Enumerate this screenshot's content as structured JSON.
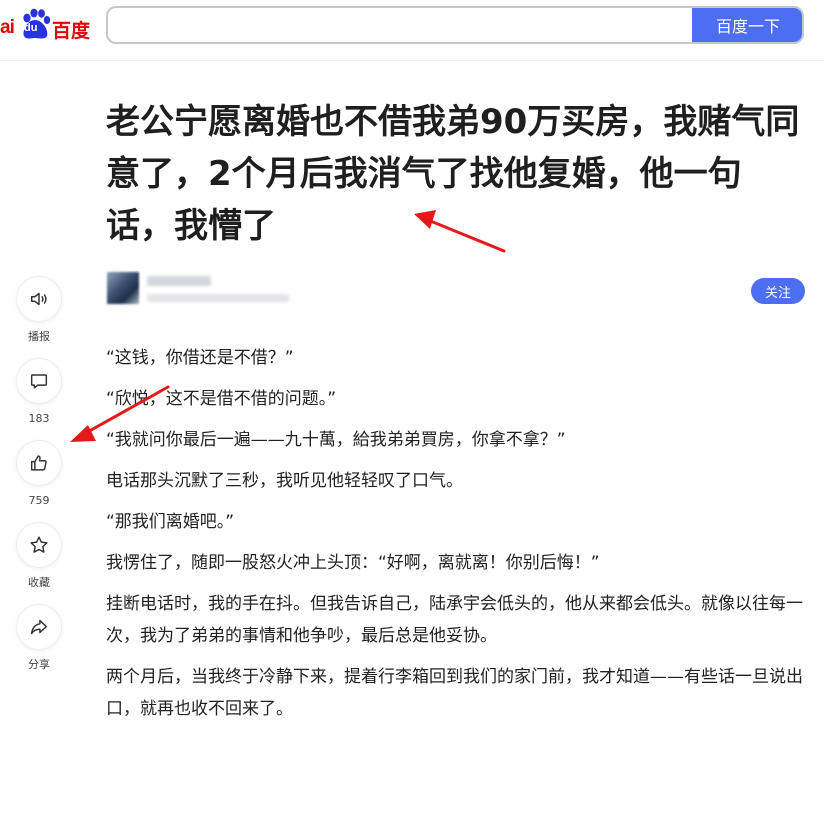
{
  "header": {
    "logo": {
      "ai": "ai",
      "du": "du",
      "cn": "百度"
    },
    "search": {
      "value": "",
      "placeholder": ""
    },
    "search_button": "百度一下"
  },
  "article": {
    "title": "老公宁愿离婚也不借我弟90万买房，我赌气同意了，2个月后我消气了找他复婚，他一句话，我懵了",
    "follow_button": "关注",
    "paragraphs": [
      "“这钱，你借还是不借？”",
      "“欣悦，这不是借不借的问题。”",
      "“我就问你最后一遍——九十萬，給我弟弟買房，你拿不拿？”",
      "电话那头沉默了三秒，我听见他轻轻叹了口气。",
      "“那我们离婚吧。”",
      "我愣住了，随即一股怒火冲上头顶：“好啊，离就离！你别后悔！”",
      "挂断电话时，我的手在抖。但我告诉自己，陆承宇会低头的，他从来都会低头。就像以往每一次，我为了弟弟的事情和他争吵，最后总是他妥协。",
      "两个月后，当我终于冷静下来，提着行李箱回到我们的家门前，我才知道——有些话一旦说出口，就再也收不回来了。"
    ]
  },
  "side_actions": [
    {
      "label": "播报",
      "icon": "speaker-icon"
    },
    {
      "label": "183",
      "icon": "comment-icon"
    },
    {
      "label": "759",
      "icon": "thumbs-up-icon"
    },
    {
      "label": "收藏",
      "icon": "star-icon"
    },
    {
      "label": "分享",
      "icon": "share-icon"
    }
  ],
  "colors": {
    "brand_red": "#e10601",
    "brand_blue": "#4e6ef2",
    "annotation_arrow": "#e5191c"
  }
}
